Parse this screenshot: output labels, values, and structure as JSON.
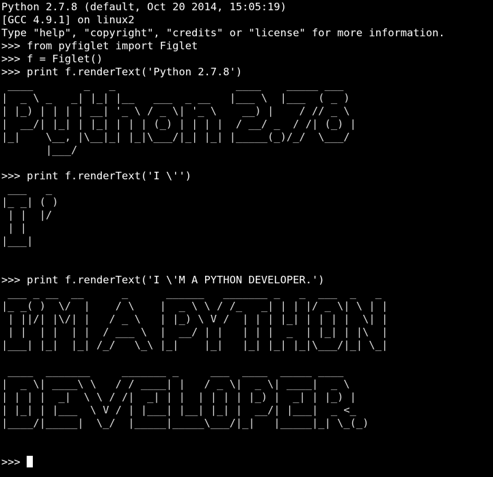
{
  "terminal": {
    "colors": {
      "background": "#000000",
      "foreground": "#ffffff"
    },
    "lines": [
      {
        "kind": "output",
        "text": "Python 2.7.8 (default, Oct 20 2014, 15:05:19)"
      },
      {
        "kind": "output",
        "text": "[GCC 4.9.1] on linux2"
      },
      {
        "kind": "output",
        "text": "Type \"help\", \"copyright\", \"credits\" or \"license\" for more information."
      },
      {
        "kind": "command",
        "text": ">>> from pyfiglet import Figlet"
      },
      {
        "kind": "command",
        "text": ">>> f = Figlet()"
      },
      {
        "kind": "command",
        "text": ">>> print f.renderText('Python 2.7.8')"
      },
      {
        "kind": "banner",
        "text": " ____        _   _                   ____    _____ ___  "
      },
      {
        "kind": "banner",
        "text": "|  _ \\ _   _| |_| |__   ___  _ __   |___ \\  |___  ( _ ) "
      },
      {
        "kind": "banner",
        "text": "| |_) | | | | __| '_ \\ / _ \\| '_ \\    __) |    / // _ \\ "
      },
      {
        "kind": "banner",
        "text": "|  __/| |_| | |_| | | | (_) | | | |  / __/ _  / /| (_) |"
      },
      {
        "kind": "banner",
        "text": "|_|    \\__, |\\__|_| |_|\\___/|_| |_| |_____(_)/_/  \\___/ "
      },
      {
        "kind": "banner",
        "text": "       |___/                                            "
      },
      {
        "kind": "output",
        "text": ""
      },
      {
        "kind": "command",
        "text": ">>> print f.renderText('I \\'')"
      },
      {
        "kind": "banner",
        "text": " ___   _ "
      },
      {
        "kind": "banner",
        "text": "|_ _| ( )"
      },
      {
        "kind": "banner",
        "text": " | |  |/ "
      },
      {
        "kind": "banner",
        "text": " | |     "
      },
      {
        "kind": "banner",
        "text": "|___|    "
      },
      {
        "kind": "output",
        "text": ""
      },
      {
        "kind": "output",
        "text": ""
      },
      {
        "kind": "command",
        "text": ">>> print f.renderText('I \\'M A PYTHON DEVELOPER.')"
      },
      {
        "kind": "banner",
        "text": " ___ _ __  __      _      ______   _______ _   _  ___  _   _ "
      },
      {
        "kind": "banner",
        "text": "|_ _( )  \\/  |    / \\    |  _ \\ \\ / /_   _| | | |/ _ \\| \\ | |"
      },
      {
        "kind": "banner",
        "text": " | ||/| |\\/| |   / _ \\   | |_) \\ V /  | | | |_| | | | |  \\| |"
      },
      {
        "kind": "banner",
        "text": " | |  | |  | |  / ___ \\  |  __/ | |   | | |  _  | |_| | |\\  |"
      },
      {
        "kind": "banner",
        "text": "|___| |_|  |_| /_/   \\_\\ |_|    |_|   |_| |_| |_|\\___/|_| \\_|"
      },
      {
        "kind": "output",
        "text": ""
      },
      {
        "kind": "banner",
        "text": " ____  _______     _______ _     ___  ____  _____ ____   "
      },
      {
        "kind": "banner",
        "text": "|  _ \\| ____\\ \\   / / ____| |   / _ \\|  _ \\| ____|  _ \\  "
      },
      {
        "kind": "banner",
        "text": "| | | |  _|  \\ \\ / /|  _| | |  | | | | |_) |  _| | |_) | "
      },
      {
        "kind": "banner",
        "text": "| |_| | |___  \\ V / | |___| |__| |_| |  __/| |___|  _ <_ "
      },
      {
        "kind": "banner",
        "text": "|____/|_____|  \\_/  |_____|_____\\___/|_|   |_____|_| \\_(_)"
      },
      {
        "kind": "output",
        "text": ""
      },
      {
        "kind": "output",
        "text": ""
      },
      {
        "kind": "prompt",
        "text": ">>> "
      }
    ]
  }
}
